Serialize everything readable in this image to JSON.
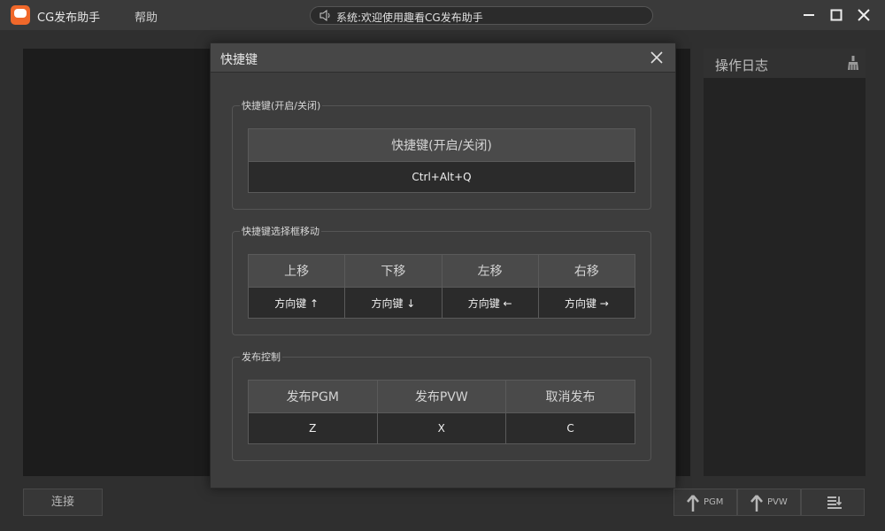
{
  "app": {
    "title": "CG发布助手",
    "help_menu": "帮助",
    "status": "系统:欢迎使用趣看CG发布助手"
  },
  "log_panel": {
    "title": "操作日志"
  },
  "bottom": {
    "connect_label": "连接",
    "pgm_label": "PGM",
    "pvw_label": "PVW"
  },
  "dialog": {
    "title": "快捷键",
    "groups": [
      {
        "title": "快捷键(开启/关闭)",
        "columns": [
          {
            "label": "快捷键(开启/关闭)",
            "key": "Ctrl+Alt+Q"
          }
        ]
      },
      {
        "title": "快捷键选择框移动",
        "columns": [
          {
            "label": "上移",
            "key": "方向键 ↑"
          },
          {
            "label": "下移",
            "key": "方向键 ↓"
          },
          {
            "label": "左移",
            "key": "方向键 ←"
          },
          {
            "label": "右移",
            "key": "方向键 →"
          }
        ]
      },
      {
        "title": "发布控制",
        "columns": [
          {
            "label": "发布PGM",
            "key": "Z"
          },
          {
            "label": "发布PVW",
            "key": "X"
          },
          {
            "label": "取消发布",
            "key": "C"
          }
        ]
      }
    ]
  },
  "colors": {
    "background": "#3a3a3a",
    "dialog": "#3d3d3d",
    "key_cell": "#2b2b2b",
    "accent_logo": "#f0682a"
  }
}
